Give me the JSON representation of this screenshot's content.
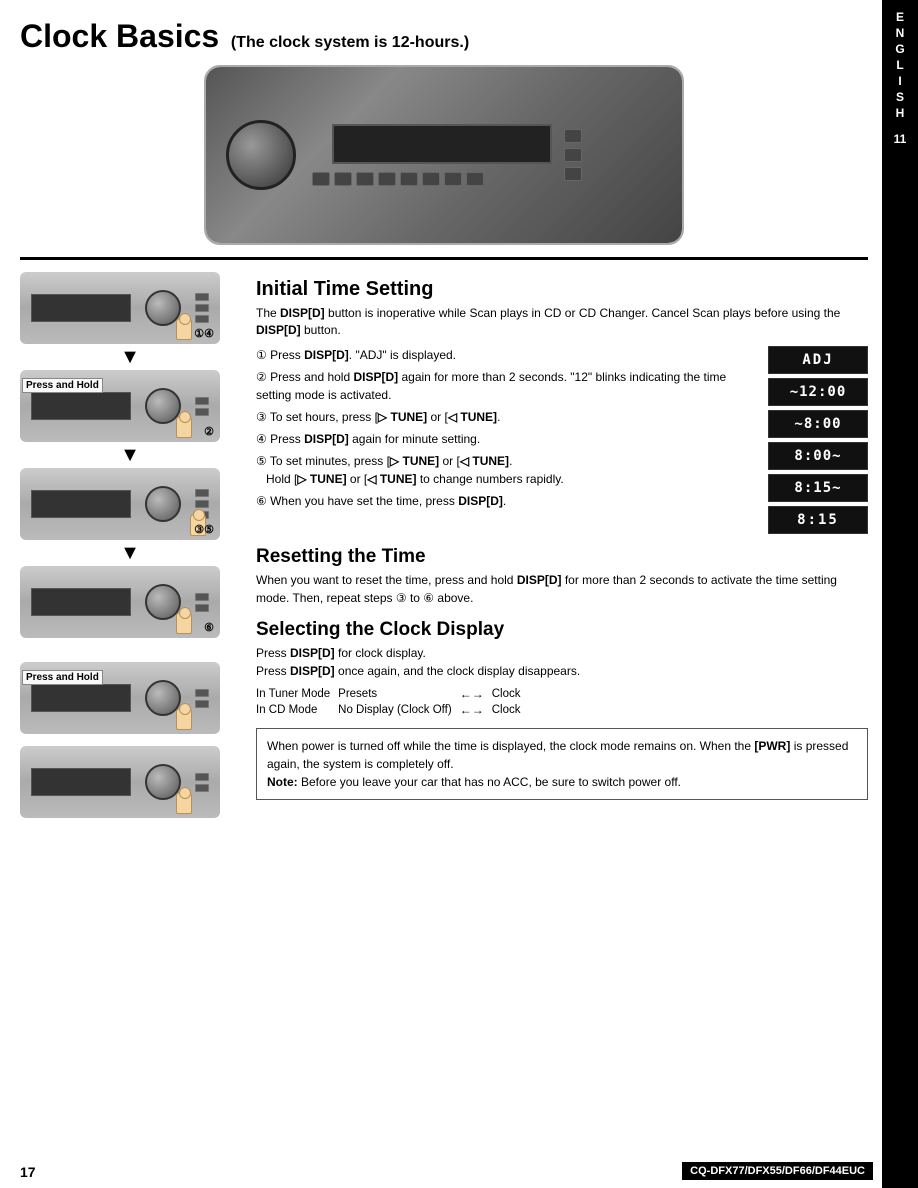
{
  "page": {
    "title_main": "Clock Basics",
    "title_sub": "(The clock system is 12-hours.)",
    "page_number": "17",
    "model_code": "CQ-DFX77/DFX55/DF66/DF44EUC"
  },
  "sidebar": {
    "letters": [
      "E",
      "N",
      "G",
      "L",
      "I",
      "S",
      "H"
    ],
    "number": "11"
  },
  "sections": {
    "initial_time_setting": {
      "title": "Initial Time Setting",
      "intro": "The DISP[D] button is inoperative while Scan plays in CD or CD Changer. Cancel Scan plays before using the DISP[D] button.",
      "steps": [
        {
          "num": "①",
          "text": "Press DISP[D]. \"ADJ\" is displayed.",
          "display": "ADJ"
        },
        {
          "num": "②",
          "text": "Press and hold DISP[D] again for more than 2 seconds. \"12\" blinks indicating the time setting mode is activated.",
          "display": "~12:00"
        },
        {
          "num": "③",
          "text": "To set hours, press [▷ TUNE] or [◁ TUNE].",
          "display": "~8:00"
        },
        {
          "num": "④",
          "text": "Press DISP[D] again for minute setting.",
          "display": "8:00~"
        },
        {
          "num": "⑤",
          "text": "To set minutes, press [▷ TUNE] or [◁ TUNE]. Hold [▷ TUNE] or [◁ TUNE] to change numbers rapidly.",
          "display": "8:15~"
        },
        {
          "num": "⑥",
          "text": "When you have set the time, press DISP[D].",
          "display": "8:15"
        }
      ]
    },
    "resetting": {
      "title": "Resetting the Time",
      "body": "When you want to reset the time, press and hold DISP[D] for more than 2 seconds to activate the time setting mode. Then, repeat steps ③ to ⑥ above."
    },
    "selecting_clock": {
      "title": "Selecting the Clock Display",
      "line1": "Press DISP[D] for clock display.",
      "line2": "Press DISP[D] once again, and the clock display disappears.",
      "table": [
        {
          "mode": "In Tuner Mode",
          "from": "Presets",
          "arrow": "←→",
          "to": "Clock"
        },
        {
          "mode": "In CD Mode",
          "from": "No Display (Clock Off)",
          "arrow": "←→",
          "to": "Clock"
        }
      ]
    },
    "note_box": {
      "text": "When power is turned off while the time is displayed, the clock mode remains on. When the [PWR] is pressed again, the system is completely off.\nNote: Before you leave your car that has no ACC, be sure to switch power off."
    }
  },
  "photos": [
    {
      "label": "",
      "steps": "①④",
      "press_hold": false
    },
    {
      "label": "Press and Hold",
      "steps": "②",
      "press_hold": true
    },
    {
      "label": "",
      "steps": "③⑤",
      "press_hold": false
    },
    {
      "label": "",
      "steps": "⑥",
      "press_hold": false
    },
    {
      "label": "Press and Hold",
      "steps": "",
      "press_hold": true
    },
    {
      "label": "",
      "steps": "",
      "press_hold": false
    }
  ],
  "displays": [
    {
      "text": "ADJ",
      "blink": false
    },
    {
      "text": "~12:00",
      "blink": true
    },
    {
      "text": "~8:00",
      "blink": true
    },
    {
      "text": "8:00~",
      "blink": true
    },
    {
      "text": "8:15~",
      "blink": true
    },
    {
      "text": "8:15",
      "blink": false
    }
  ]
}
